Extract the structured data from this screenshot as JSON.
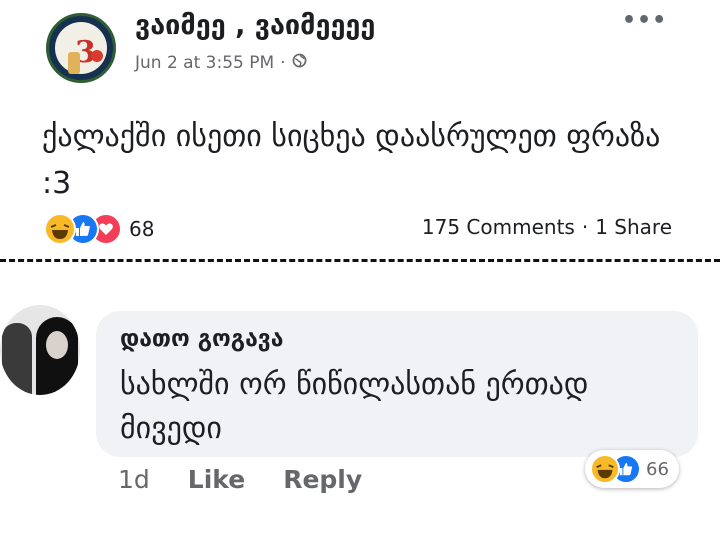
{
  "post": {
    "author": "ვაიმეე , ვაიმეეეე",
    "date": "Jun 2 at 3:55 PM",
    "meta_separator": "·",
    "privacy_icon": "globe-icon",
    "body": "ქალაქში ისეთი სიცხეა დაასრულეთ ფრაზა :3",
    "reactions": [
      "haha",
      "like",
      "love"
    ],
    "reaction_count": "68",
    "comments": "175 Comments",
    "stats_separator": "·",
    "shares": "1 Share"
  },
  "comment": {
    "author": "დათო გოგავა",
    "text": "სახლში ორ წიწილასთან ერთად მივედი",
    "time": "1d",
    "like_label": "Like",
    "reply_label": "Reply",
    "reactions": [
      "haha",
      "like"
    ],
    "reaction_count": "66"
  },
  "colors": {
    "haha": "#f7b928",
    "like": "#1877f2",
    "love": "#f33e58",
    "muted_text": "#65676b",
    "bubble": "#f0f2f5"
  }
}
